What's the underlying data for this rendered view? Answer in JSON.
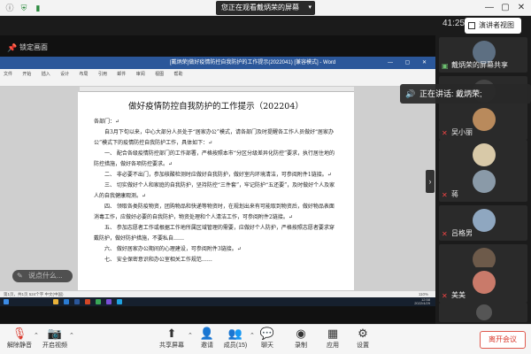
{
  "topbar": {
    "share_status": "您正在观看戴炳荣的屏幕",
    "icons": [
      "info-icon",
      "shield-icon",
      "signal-icon"
    ],
    "window_controls": [
      "minimize",
      "maximize",
      "close"
    ]
  },
  "bar2": {
    "timer": "41:25",
    "speaker_view_label": "演讲者视图"
  },
  "share_toolbar": {
    "lock_label": "锁定画面"
  },
  "word": {
    "title_text": "[戴炳荣]做好疫情防控自我防护的工作提示(2022041) [兼容模式] - Word",
    "ribbon_tabs": "文件 开始 插入 设计 布局 引用 邮件 审阅 视图 帮助",
    "doc_title": "做好疫情防控自我防护的工作提示（202204）",
    "paragraphs": [
      "各部门：↵",
      "自3月下旬以来，中心大部分人员处于“居家办公”模式，请各部门及时提醒各工作人员做好“居家办公”模式下的疫情防控自我防护工作，具体如下：↵",
      "一、 配合各级疫情防控部门的工作部署，严格按照本市“分区分级差异化防控”要求，执行居住地的防控措施，做好各项防控要求。↵",
      "二、 非必要不出门，参加核酸检测时应做好自我防护，做好室内环境清洁，可参阅附件1链接。↵",
      "三、 切实做好个人和家庭的自我防护，坚持防控“三件套”，牢记防护“五还要”，及时做好个人及家人的自我健康观测。↵",
      "四、 领取各类防疫物资，团购物品和快递等物资时，在规划出来有可能取到物资后，做好物品表面消毒工作，应做好必要的自我防护，物资处理和个人清洁工作，可参阅附件2链接。↵",
      "五、 参加志愿者工作或根据工作地所属区域管理的需要，应做好个人防护，严格按照志愿者要求穿戴防护，做好防护措施，不要私自……",
      "六、 做好居家办公期间的心理建设，可参阅附件3链接。↵",
      "七、 安全保密意识和办公室相关工作规范……"
    ],
    "status_text": "第1页，共1页  524个字  中文(中国)",
    "zoom_text": "110%",
    "clock_time": "12:58",
    "clock_date": "2022/4/29"
  },
  "chat": {
    "placeholder": "说点什么..."
  },
  "participants": {
    "active_share_name": "戴炳荣的屏幕共享",
    "talking_label": "正在讲话: 戴炳荣;",
    "tiles": [
      {
        "name": "戴炳荣的屏幕共享",
        "color": "#5d6f82"
      },
      {
        "name": "",
        "color": "#3a3a3a"
      },
      {
        "name": "吴小丽",
        "color": "#b98a5c"
      },
      {
        "name": "",
        "color": "#d8c9a8"
      },
      {
        "name": "蒋",
        "color": "#8a9aa8"
      },
      {
        "name": "",
        "color": "#2a2a2a"
      },
      {
        "name": "吕格男",
        "color": "#8fa7c0"
      },
      {
        "name": "",
        "color": "#6d5a4a"
      },
      {
        "name": "美美",
        "color": "#c97a6a"
      },
      {
        "name": "",
        "color": "#2a2a2a"
      }
    ]
  },
  "bottombar": {
    "mute_label": "解除静音",
    "video_label": "开启视频",
    "share_label": "共享屏幕",
    "invite_label": "邀请",
    "members_label": "成员(15)",
    "chat_label": "聊天",
    "record_label": "录制",
    "apps_label": "应用",
    "settings_label": "设置",
    "leave_label": "离开会议"
  },
  "colors": {
    "word_blue": "#2b579a",
    "leave_red": "#d9382b",
    "muted_red": "#e44444"
  }
}
